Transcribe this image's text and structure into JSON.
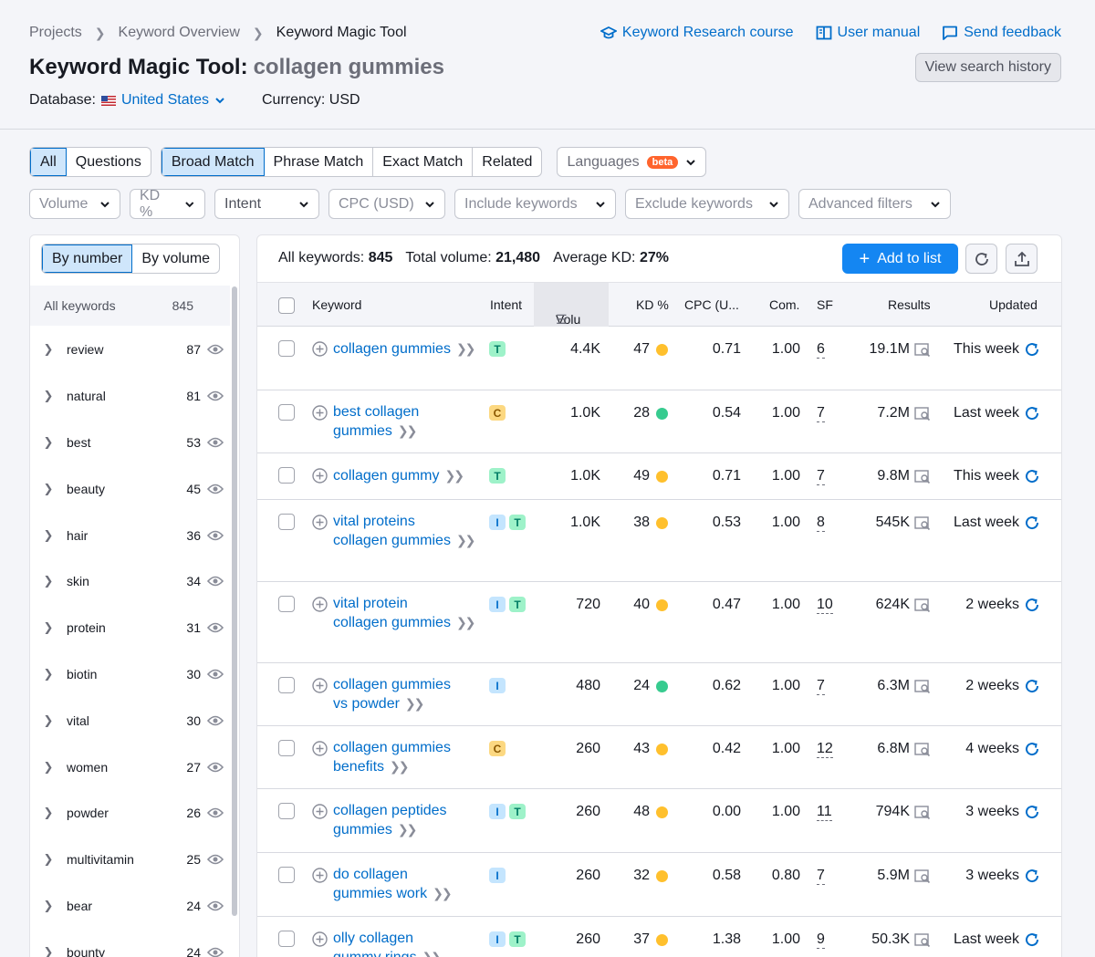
{
  "breadcrumbs": [
    "Projects",
    "Keyword Overview",
    "Keyword Magic Tool"
  ],
  "toplinks": {
    "course": "Keyword Research course",
    "manual": "User manual",
    "feedback": "Send feedback"
  },
  "title": {
    "main": "Keyword Magic Tool:",
    "query": "collagen gummies"
  },
  "history_button": "View search history",
  "database": {
    "label": "Database:",
    "value": "United States",
    "currency": "Currency: USD"
  },
  "tabs": {
    "all": "All",
    "questions": "Questions",
    "broad": "Broad Match",
    "phrase": "Phrase Match",
    "exact": "Exact Match",
    "related": "Related",
    "languages": "Languages",
    "beta": "beta"
  },
  "filters": {
    "volume": "Volume",
    "kd": "KD %",
    "intent": "Intent",
    "cpc": "CPC (USD)",
    "include": "Include keywords",
    "exclude": "Exclude keywords",
    "advanced": "Advanced filters"
  },
  "sidebar": {
    "by_number": "By number",
    "by_volume": "By volume",
    "all_label": "All keywords",
    "all_count": "845",
    "items": [
      {
        "label": "review",
        "count": "87"
      },
      {
        "label": "natural",
        "count": "81"
      },
      {
        "label": "best",
        "count": "53"
      },
      {
        "label": "beauty",
        "count": "45"
      },
      {
        "label": "hair",
        "count": "36"
      },
      {
        "label": "skin",
        "count": "34"
      },
      {
        "label": "protein",
        "count": "31"
      },
      {
        "label": "biotin",
        "count": "30"
      },
      {
        "label": "vital",
        "count": "30"
      },
      {
        "label": "women",
        "count": "27"
      },
      {
        "label": "powder",
        "count": "26"
      },
      {
        "label": "multivitamin",
        "count": "25"
      },
      {
        "label": "bear",
        "count": "24"
      },
      {
        "label": "bounty",
        "count": "24"
      }
    ]
  },
  "summary": {
    "all_label": "All keywords:",
    "all_value": "845",
    "vol_label": "Total volume:",
    "vol_value": "21,480",
    "kd_label": "Average KD:",
    "kd_value": "27%"
  },
  "add_button": "Add to list",
  "columns": {
    "keyword": "Keyword",
    "intent": "Intent",
    "volume": "Volu",
    "kd": "KD %",
    "cpc": "CPC (U...",
    "com": "Com.",
    "sf": "SF",
    "results": "Results",
    "updated": "Updated"
  },
  "colors": {
    "kd_yellow": "#ffc02d",
    "kd_green": "#37cb8f",
    "link": "#006dca"
  },
  "rows": [
    {
      "keyword": [
        "collagen gummies"
      ],
      "intent": [
        "T"
      ],
      "volume": "4.4K",
      "kd": "47",
      "kd_color": "yellow",
      "cpc": "0.71",
      "com": "1.00",
      "sf": "6",
      "results": "19.1M",
      "updated": "This week",
      "height": 70
    },
    {
      "keyword": [
        "best collagen",
        "gummies"
      ],
      "intent": [
        "C"
      ],
      "volume": "1.0K",
      "kd": "28",
      "kd_color": "green",
      "cpc": "0.54",
      "com": "1.00",
      "sf": "7",
      "results": "7.2M",
      "updated": "Last week",
      "height": 69
    },
    {
      "keyword": [
        "collagen gummy"
      ],
      "intent": [
        "T"
      ],
      "volume": "1.0K",
      "kd": "49",
      "kd_color": "yellow",
      "cpc": "0.71",
      "com": "1.00",
      "sf": "7",
      "results": "9.8M",
      "updated": "This week",
      "height": 51
    },
    {
      "keyword": [
        "vital proteins",
        "collagen gummies"
      ],
      "intent": [
        "I",
        "T"
      ],
      "volume": "1.0K",
      "kd": "38",
      "kd_color": "yellow",
      "cpc": "0.53",
      "com": "1.00",
      "sf": "8",
      "results": "545K",
      "updated": "Last week",
      "height": 90
    },
    {
      "keyword": [
        "vital protein",
        "collagen gummies"
      ],
      "intent": [
        "I",
        "T"
      ],
      "volume": "720",
      "kd": "40",
      "kd_color": "yellow",
      "cpc": "0.47",
      "com": "1.00",
      "sf": "10",
      "results": "624K",
      "updated": "2 weeks",
      "height": 89
    },
    {
      "keyword": [
        "collagen gummies",
        "vs powder"
      ],
      "intent": [
        "I"
      ],
      "volume": "480",
      "kd": "24",
      "kd_color": "green",
      "cpc": "0.62",
      "com": "1.00",
      "sf": "7",
      "results": "6.3M",
      "updated": "2 weeks",
      "height": 69
    },
    {
      "keyword": [
        "collagen gummies",
        "benefits"
      ],
      "intent": [
        "C"
      ],
      "volume": "260",
      "kd": "43",
      "kd_color": "yellow",
      "cpc": "0.42",
      "com": "1.00",
      "sf": "12",
      "results": "6.8M",
      "updated": "4 weeks",
      "height": 69
    },
    {
      "keyword": [
        "collagen peptides",
        "gummies"
      ],
      "intent": [
        "I",
        "T"
      ],
      "volume": "260",
      "kd": "48",
      "kd_color": "yellow",
      "cpc": "0.00",
      "com": "1.00",
      "sf": "11",
      "results": "794K",
      "updated": "3 weeks",
      "height": 70
    },
    {
      "keyword": [
        "do collagen",
        "gummies work"
      ],
      "intent": [
        "I"
      ],
      "volume": "260",
      "kd": "32",
      "kd_color": "yellow",
      "cpc": "0.58",
      "com": "0.80",
      "sf": "7",
      "results": "5.9M",
      "updated": "3 weeks",
      "height": 70
    },
    {
      "keyword": [
        "olly collagen",
        "gummy rings"
      ],
      "intent": [
        "I",
        "T"
      ],
      "volume": "260",
      "kd": "37",
      "kd_color": "yellow",
      "cpc": "1.38",
      "com": "1.00",
      "sf": "9",
      "results": "50.3K",
      "updated": "Last week",
      "height": 70
    }
  ]
}
